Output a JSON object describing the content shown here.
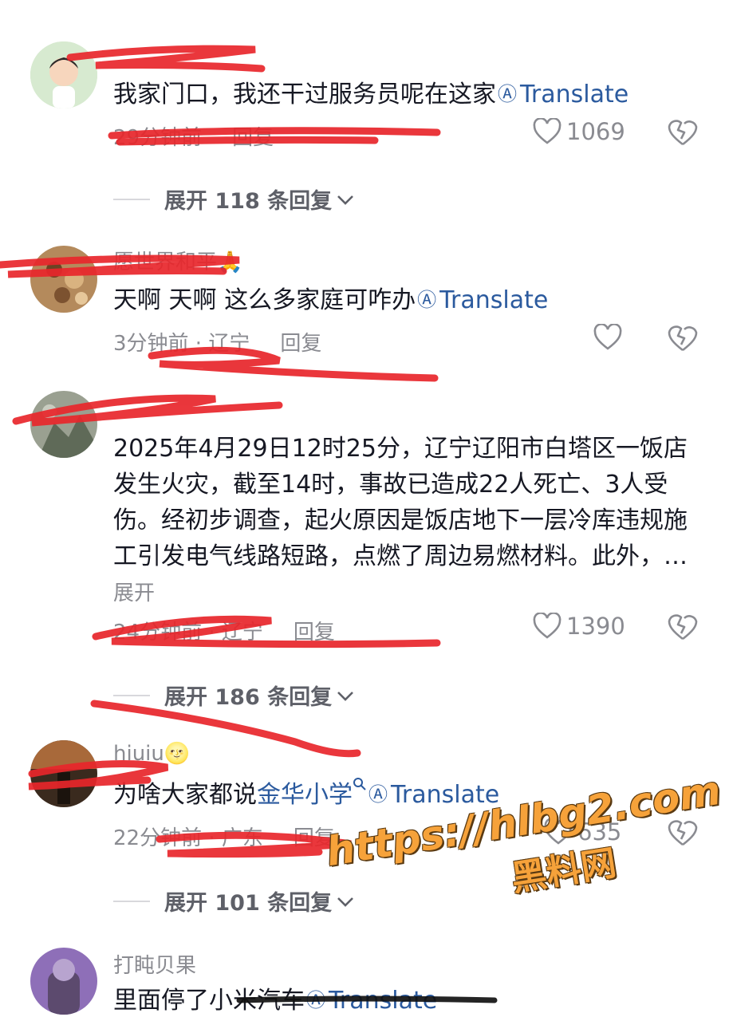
{
  "comments": [
    {
      "username": "",
      "text": "我家门口，我还干过服务员呢在这家",
      "translate": "Translate",
      "time": "29分钟前",
      "reply": "回复",
      "likes": "1069",
      "replies_label": "展开 118 条回复"
    },
    {
      "username": "愿世界和平🙏",
      "text": "天啊 天啊 这么多家庭可咋办",
      "translate": "Translate",
      "time": "3分钟前 · 辽宁",
      "reply": "回复",
      "likes": ""
    },
    {
      "username": "",
      "text": "2025年4月29日12时25分，辽宁辽阳市白塔区一饭店发生火灾，截至14时，事故已造成22人死亡、3人受伤。经初步调查，起火原因是饭店地下一层冷库违规施工引发电气线路短路，点燃了周边易燃材料。此外，…",
      "expand": "展开",
      "time": "24分钟前 · 辽宁",
      "reply": "回复",
      "likes": "1390",
      "replies_label": "展开 186 条回复"
    },
    {
      "username": "hiuiu🌝",
      "text_prefix": "为啥大家都说",
      "link": "金华小学",
      "translate": "Translate",
      "time": "22分钟前 · 广东",
      "reply": "回复",
      "likes": "635",
      "replies_label": "展开 101 条回复"
    },
    {
      "username": "打盹贝果",
      "text": "里面停了小米汽车",
      "translate": "Translate"
    }
  ],
  "watermark": {
    "line1": "https://hlbg2.com",
    "line2": "黑料网"
  },
  "colors": {
    "text": "#161823",
    "secondary": "#8a8b91",
    "link": "#2b5a9e",
    "scribble": "#e8262b",
    "watermark": "#f6a23a"
  },
  "icons": [
    "heart-icon",
    "heart-broken-icon",
    "translate-icon",
    "chevron-down-icon",
    "search-icon"
  ]
}
